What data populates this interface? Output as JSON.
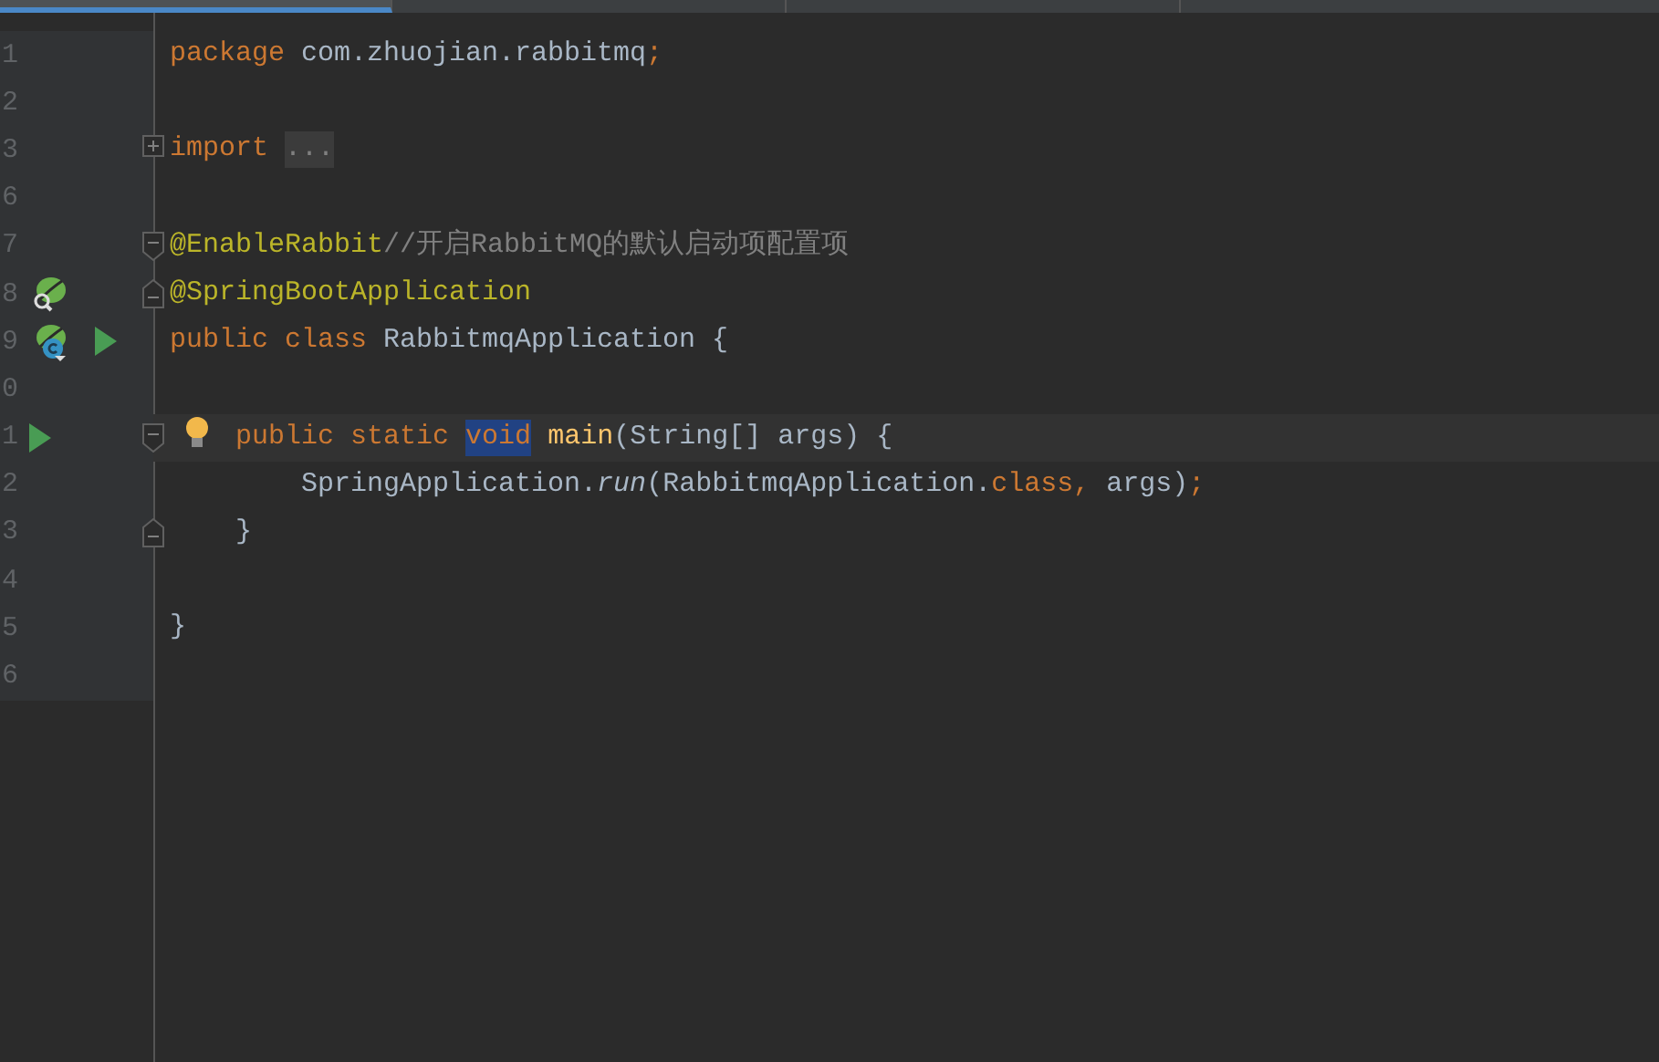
{
  "tabs": [
    {
      "selected": true
    },
    {
      "selected": false
    },
    {
      "selected": false
    }
  ],
  "lines": [
    {
      "number": "1",
      "current": false,
      "tokens": [
        {
          "kind": "keyword",
          "text": "package "
        },
        {
          "kind": "plain",
          "text": "com.zhuojian.rabbitmq"
        },
        {
          "kind": "keyword",
          "text": ";"
        }
      ]
    },
    {
      "number": "2",
      "current": false
    },
    {
      "number": "3",
      "current": false,
      "fold": {
        "kind": "expand"
      },
      "tokens": [
        {
          "kind": "keyword",
          "text": "import "
        },
        {
          "kind": "folded",
          "text": "..."
        }
      ]
    },
    {
      "number": "6",
      "current": false
    },
    {
      "number": "7",
      "current": false,
      "fold": {
        "kind": "start"
      },
      "tokens": [
        {
          "kind": "annotation",
          "text": "@EnableRabbit"
        },
        {
          "kind": "comment",
          "text": "//开启RabbitMQ的默认启动项配置项"
        }
      ]
    },
    {
      "number": "8",
      "current": false,
      "fold": {
        "kind": "end"
      },
      "markers": [
        {
          "kind": "bean-search"
        }
      ],
      "tokens": [
        {
          "kind": "annotation",
          "text": "@SpringBootApplication"
        }
      ]
    },
    {
      "number": "9",
      "current": false,
      "markers": [
        {
          "kind": "bean"
        },
        {
          "kind": "run"
        }
      ],
      "tokens": [
        {
          "kind": "keyword",
          "text": "public class "
        },
        {
          "kind": "plain",
          "text": "RabbitmqApplication {"
        }
      ]
    },
    {
      "number": "0",
      "current": false
    },
    {
      "number": "1",
      "current": true,
      "fold": {
        "kind": "start"
      },
      "markers": [
        {
          "kind": "run"
        }
      ],
      "bulb": true,
      "tokens": [
        {
          "kind": "keyword",
          "text": "    public static "
        },
        {
          "kind": "selected-keyword",
          "text": "void"
        },
        {
          "kind": "method",
          "text": " main"
        },
        {
          "kind": "plain",
          "text": "(String[] args) {"
        }
      ]
    },
    {
      "number": "2",
      "current": false,
      "tokens": [
        {
          "kind": "plain",
          "text": "        SpringApplication."
        },
        {
          "kind": "static-call",
          "text": "run"
        },
        {
          "kind": "plain",
          "text": "(RabbitmqApplication."
        },
        {
          "kind": "keyword",
          "text": "class, "
        },
        {
          "kind": "plain",
          "text": "args)"
        },
        {
          "kind": "keyword",
          "text": ";"
        }
      ]
    },
    {
      "number": "3",
      "current": false,
      "fold": {
        "kind": "end"
      },
      "tokens": [
        {
          "kind": "plain",
          "text": "    }"
        }
      ]
    },
    {
      "number": "4",
      "current": false
    },
    {
      "number": "5",
      "current": false,
      "tokens": [
        {
          "kind": "plain",
          "text": "}"
        }
      ]
    },
    {
      "number": "6",
      "current": false
    }
  ]
}
